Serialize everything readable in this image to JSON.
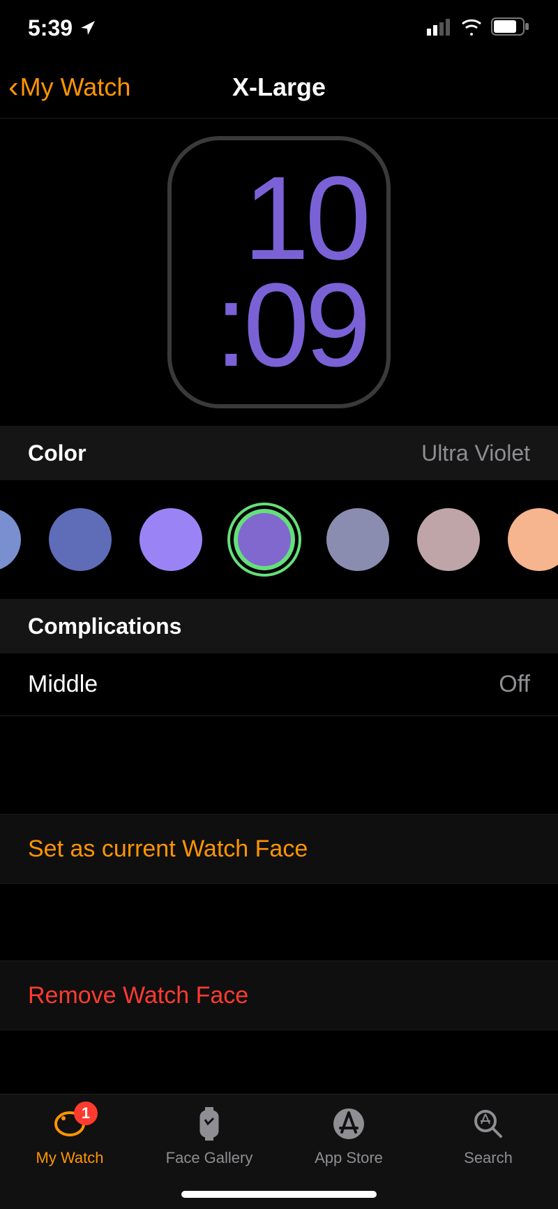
{
  "status": {
    "time": "5:39",
    "locationIcon": "location-icon",
    "cellular_bars": 2,
    "wifi": true,
    "battery_pct": 75
  },
  "nav": {
    "back_label": "My Watch",
    "title": "X-Large"
  },
  "preview": {
    "time_top": "10",
    "time_bottom": ":09",
    "color_hex": "#7a62d6"
  },
  "color_section": {
    "label": "Color",
    "current": "Ultra Violet",
    "swatches": [
      {
        "hex": "#7a8fd0",
        "partial": "left"
      },
      {
        "hex": "#5f6cb8"
      },
      {
        "hex": "#9a84f5"
      },
      {
        "hex": "#8068cf",
        "selected": true
      },
      {
        "hex": "#8a8cb0"
      },
      {
        "hex": "#bfa5a8"
      },
      {
        "hex": "#f6b48f",
        "partial": "right"
      }
    ]
  },
  "complications": {
    "label": "Complications",
    "rows": [
      {
        "label": "Middle",
        "value": "Off"
      }
    ]
  },
  "actions": {
    "set_current": "Set as current Watch Face",
    "remove": "Remove Watch Face"
  },
  "tabs": [
    {
      "label": "My Watch",
      "icon": "watch-icon",
      "active": true,
      "badge": "1"
    },
    {
      "label": "Face Gallery",
      "icon": "face-gallery-icon"
    },
    {
      "label": "App Store",
      "icon": "app-store-icon"
    },
    {
      "label": "Search",
      "icon": "search-icon"
    }
  ]
}
